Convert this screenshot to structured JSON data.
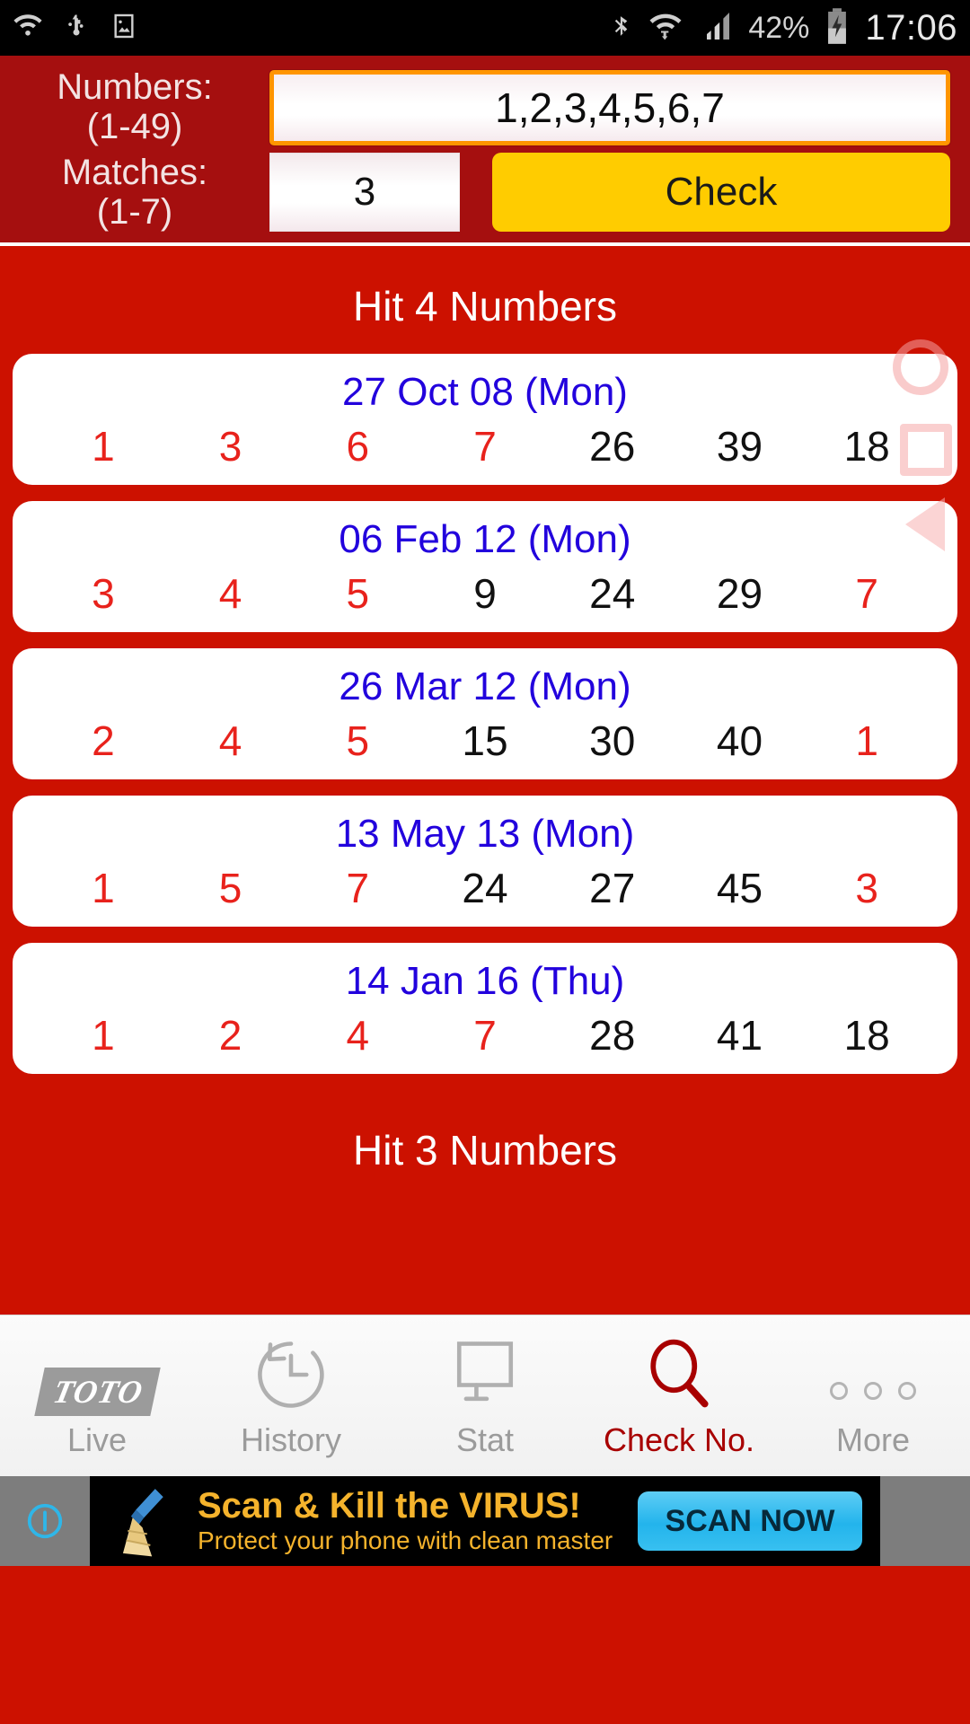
{
  "statusbar": {
    "left_icons": [
      "wifi-question-icon",
      "usb-icon",
      "screenshot-icon"
    ],
    "right_icons": [
      "bluetooth-icon",
      "wifi-icon",
      "signal-icon",
      "battery-charging-icon"
    ],
    "battery_percent": "42%",
    "clock": "17:06"
  },
  "panel": {
    "numbers_label": "Numbers:",
    "numbers_range": "(1-49)",
    "numbers_value": "1,2,3,4,5,6,7",
    "numbers_placeholder": "1,2,3,4,5,6,7",
    "matches_label": "Matches:",
    "matches_range": "(1-7)",
    "matches_value": "3",
    "matches_placeholder": "3",
    "check_label": "Check",
    "accent_border": "#ff9500",
    "button_color": "#ffcc00",
    "panel_color": "#a50f0f"
  },
  "results": {
    "section_title": "Hit 4 Numbers",
    "next_section_title": "Hit 3 Numbers",
    "background_color": "#cc1100",
    "hit_color": "#e8221c",
    "date_color": "#2200dd",
    "cards": [
      {
        "date": "27 Oct 08 (Mon)",
        "numbers": [
          {
            "value": "1",
            "hit": true
          },
          {
            "value": "3",
            "hit": true
          },
          {
            "value": "6",
            "hit": true
          },
          {
            "value": "7",
            "hit": true
          },
          {
            "value": "26",
            "hit": false
          },
          {
            "value": "39",
            "hit": false
          },
          {
            "value": "18",
            "hit": false
          }
        ],
        "marks": [
          "circle",
          "square"
        ]
      },
      {
        "date": "06 Feb 12 (Mon)",
        "numbers": [
          {
            "value": "3",
            "hit": true
          },
          {
            "value": "4",
            "hit": true
          },
          {
            "value": "5",
            "hit": true
          },
          {
            "value": "9",
            "hit": false
          },
          {
            "value": "24",
            "hit": false
          },
          {
            "value": "29",
            "hit": false
          },
          {
            "value": "7",
            "hit": true
          }
        ],
        "marks": [
          "triangle"
        ]
      },
      {
        "date": "26 Mar 12 (Mon)",
        "numbers": [
          {
            "value": "2",
            "hit": true
          },
          {
            "value": "4",
            "hit": true
          },
          {
            "value": "5",
            "hit": true
          },
          {
            "value": "15",
            "hit": false
          },
          {
            "value": "30",
            "hit": false
          },
          {
            "value": "40",
            "hit": false
          },
          {
            "value": "1",
            "hit": true
          }
        ],
        "marks": []
      },
      {
        "date": "13 May 13 (Mon)",
        "numbers": [
          {
            "value": "1",
            "hit": true
          },
          {
            "value": "5",
            "hit": true
          },
          {
            "value": "7",
            "hit": true
          },
          {
            "value": "24",
            "hit": false
          },
          {
            "value": "27",
            "hit": false
          },
          {
            "value": "45",
            "hit": false
          },
          {
            "value": "3",
            "hit": true
          }
        ],
        "marks": []
      },
      {
        "date": "14 Jan 16 (Thu)",
        "numbers": [
          {
            "value": "1",
            "hit": true
          },
          {
            "value": "2",
            "hit": true
          },
          {
            "value": "4",
            "hit": true
          },
          {
            "value": "7",
            "hit": true
          },
          {
            "value": "28",
            "hit": false
          },
          {
            "value": "41",
            "hit": false
          },
          {
            "value": "18",
            "hit": false
          }
        ],
        "marks": []
      }
    ]
  },
  "navbar": {
    "active_color": "#a80000",
    "items": [
      {
        "label": "Live",
        "icon": "toto-logo-icon",
        "logo_text": "TOTO",
        "active": false
      },
      {
        "label": "History",
        "icon": "history-clock-icon",
        "active": false
      },
      {
        "label": "Stat",
        "icon": "monitor-icon",
        "active": false
      },
      {
        "label": "Check No.",
        "icon": "magnifier-icon",
        "active": true
      },
      {
        "label": "More",
        "icon": "more-dots-icon",
        "active": false
      }
    ]
  },
  "ad": {
    "headline": "Scan & Kill the VIRUS!",
    "subline": "Protect your phone with clean master",
    "cta_label": "SCAN NOW",
    "icon": "broom-icon",
    "info_icon": "ad-info-icon"
  }
}
